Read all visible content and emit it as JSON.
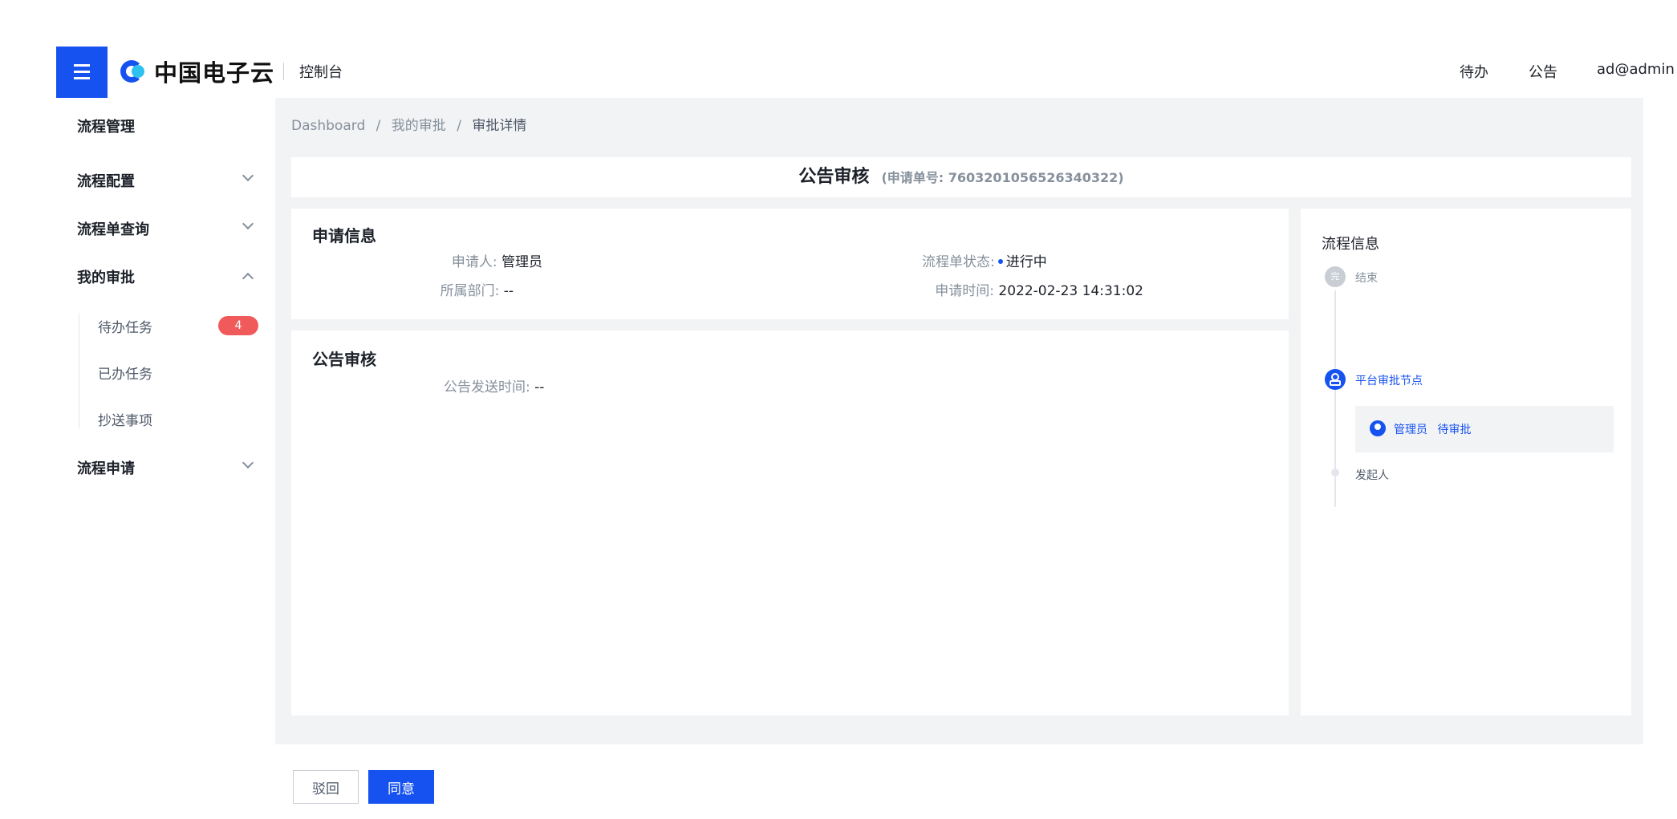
{
  "header": {
    "logo_text": "中国电子云",
    "console_label": "控制台",
    "links": [
      "待办",
      "公告",
      "ad@admin"
    ]
  },
  "sidebar": {
    "title": "流程管理",
    "groups": [
      {
        "label": "流程配置",
        "expanded": false
      },
      {
        "label": "流程单查询",
        "expanded": false
      },
      {
        "label": "我的审批",
        "expanded": true
      },
      {
        "label": "流程申请",
        "expanded": false
      }
    ],
    "sub_items": [
      {
        "label": "待办任务",
        "badge": "4"
      },
      {
        "label": "已办任务"
      },
      {
        "label": "抄送事项"
      }
    ]
  },
  "breadcrumb": {
    "items": [
      "Dashboard",
      "我的审批",
      "审批详情"
    ],
    "separator": "/"
  },
  "title_card": {
    "title": "公告审核",
    "number": "(申请单号: 7603201056526340322)"
  },
  "apply_info": {
    "heading": "申请信息",
    "applicant_label": "申请人:",
    "applicant_value": "管理员",
    "department_label": "所属部门:",
    "department_value": "--",
    "status_label": "流程单状态:",
    "status_value": "进行中",
    "time_label": "申请时间:",
    "time_value": "2022-02-23 14:31:02"
  },
  "notice_review": {
    "heading": "公告审核",
    "send_time_label": "公告发送时间:",
    "send_time_value": "--"
  },
  "flow_info": {
    "title": "流程信息",
    "end_icon_text": "完",
    "end_label": "结束",
    "node_label": "平台审批节点",
    "assignee_name": "管理员",
    "assignee_status": "待审批",
    "initiator_label": "发起人"
  },
  "actions": {
    "reject_label": "驳回",
    "approve_label": "同意"
  },
  "colors": {
    "primary": "#1652f0",
    "badge": "#f05a5a",
    "page_bg": "#f2f3f5"
  }
}
